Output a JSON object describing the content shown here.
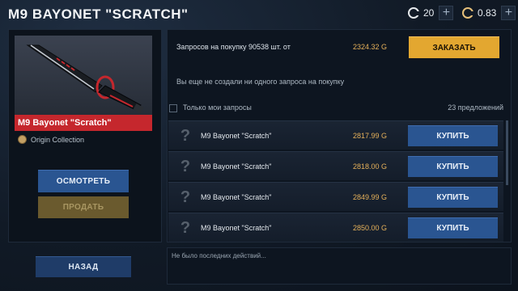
{
  "header": {
    "title": "M9 BAYONET \"SCRATCH\"",
    "credits": "20",
    "gold": "0.83",
    "plus": "+"
  },
  "item": {
    "name": "M9 Bayonet \"Scratch\"",
    "collection": "Origin Collection"
  },
  "actions": {
    "view": "ОСМОТРЕТЬ",
    "sell": "ПРОДАТЬ",
    "back": "НАЗАД"
  },
  "order": {
    "text": "Запросов на покупку 90538 шт. от",
    "price": "2324.32 G",
    "button": "ЗАКАЗАТЬ",
    "no_requests": "Вы еще не создали ни одного запроса на покупку"
  },
  "filter": {
    "only_mine": "Только мои запросы",
    "offers": "23 предложений"
  },
  "listings": [
    {
      "name": "M9 Bayonet \"Scratch\"",
      "price": "2817.99 G",
      "buy": "КУПИТЬ"
    },
    {
      "name": "M9 Bayonet \"Scratch\"",
      "price": "2818.00 G",
      "buy": "КУПИТЬ"
    },
    {
      "name": "M9 Bayonet \"Scratch\"",
      "price": "2849.99 G",
      "buy": "КУПИТЬ"
    },
    {
      "name": "M9 Bayonet \"Scratch\"",
      "price": "2850.00 G",
      "buy": "КУПИТЬ"
    }
  ],
  "log": {
    "empty": "Не было последних действий..."
  },
  "colors": {
    "accent_red": "#c5272d",
    "buy_blue": "#2a5591",
    "order_gold": "#e3a730",
    "price_gold": "#e6b15a"
  }
}
